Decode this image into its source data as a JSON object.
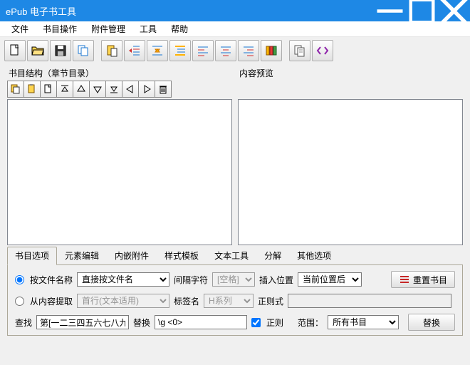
{
  "app_title": "ePub 电子书工具",
  "menu": [
    "文件",
    "书目操作",
    "附件管理",
    "工具",
    "帮助"
  ],
  "main_toolbar": [
    {
      "name": "new-icon",
      "type": "new"
    },
    {
      "name": "open-icon",
      "type": "open"
    },
    {
      "name": "save-icon",
      "type": "save"
    },
    {
      "name": "copy-icon",
      "type": "copy"
    },
    {
      "name": "paste-icon",
      "type": "paste"
    },
    {
      "name": "outdent-icon",
      "type": "outdent"
    },
    {
      "name": "indent-icon",
      "type": "indent"
    },
    {
      "name": "left-indent-icon",
      "type": "lindent"
    },
    {
      "name": "align-left-icon",
      "type": "alignl"
    },
    {
      "name": "align-center-icon",
      "type": "alignc"
    },
    {
      "name": "align-right-icon",
      "type": "alignr"
    },
    {
      "name": "books-icon",
      "type": "books"
    },
    {
      "name": "pages-icon",
      "type": "pages"
    },
    {
      "name": "code-icon",
      "type": "code"
    }
  ],
  "tree_title": "书目结构（章节目录）",
  "preview_title": "内容预览",
  "tree_toolbar": [
    {
      "name": "copy-icon",
      "type": "tcopy"
    },
    {
      "name": "paste-icon",
      "type": "tpaste"
    },
    {
      "name": "new-node-icon",
      "type": "tnew"
    },
    {
      "name": "move-top-icon",
      "type": "ttop"
    },
    {
      "name": "move-up-icon",
      "type": "tup"
    },
    {
      "name": "move-down-icon",
      "type": "tdown"
    },
    {
      "name": "move-bottom-icon",
      "type": "tbottom"
    },
    {
      "name": "move-left-icon",
      "type": "tleft"
    },
    {
      "name": "move-right-icon",
      "type": "tright"
    },
    {
      "name": "delete-icon",
      "type": "tdelete"
    }
  ],
  "tabs": [
    "书目选项",
    "元素编辑",
    "内嵌附件",
    "样式模板",
    "文本工具",
    "分解",
    "其他选项"
  ],
  "options": {
    "radio_by_filename": "按文件名称",
    "radio_by_content": "从内容提取",
    "filename_mode_sel": "直接按文件名",
    "content_mode_sel": "首行(文本适用)",
    "sep_label": "间隔字符",
    "sep_value": "[空格]",
    "insert_label": "插入位置",
    "insert_value": "当前位置后",
    "tag_label": "标签名",
    "tag_value": "H系列",
    "regex_label": "正则式",
    "reset_label": "重置书目",
    "find_label": "查找",
    "find_value": "第[一二三四五六七八九",
    "replace_label": "替换",
    "replace_value": "\\g <0>",
    "regex_cb": "正则",
    "scope_label": "范围：",
    "scope_value": "所有书目",
    "replace_btn": "替换"
  }
}
